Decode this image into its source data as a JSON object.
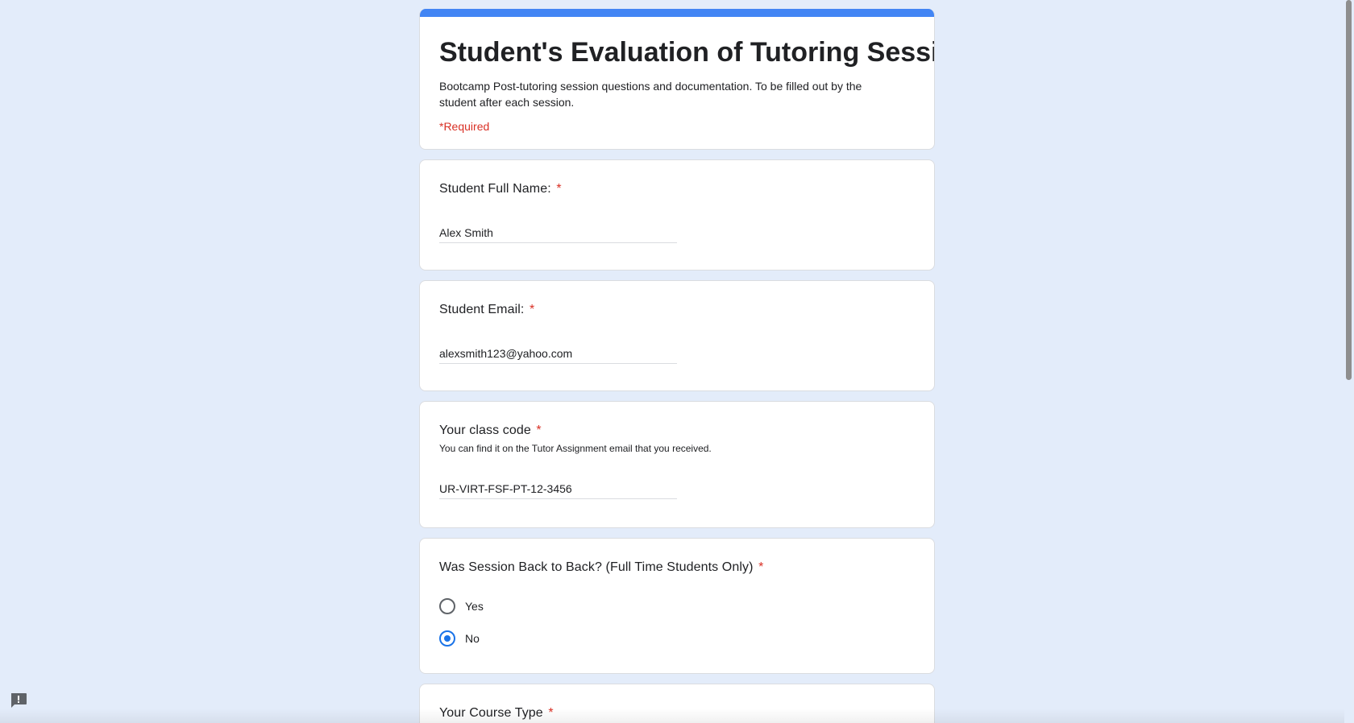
{
  "header": {
    "title": "Student's Evaluation of Tutoring Session.",
    "description": "Bootcamp Post-tutoring session questions and documentation.  To be filled out by the student after each session.",
    "required_note": "*Required",
    "accent_color": "#4285f4"
  },
  "questions": {
    "full_name": {
      "title": "Student Full Name:",
      "required_mark": "*",
      "value": "Alex Smith"
    },
    "email": {
      "title": "Student Email:",
      "required_mark": "*",
      "value": "alexsmith123@yahoo.com"
    },
    "class_code": {
      "title": "Your class code",
      "required_mark": "*",
      "help": "You can find it on the Tutor Assignment email that you received.",
      "value": "UR-VIRT-FSF-PT-12-3456"
    },
    "back_to_back": {
      "title": "Was Session Back to Back? (Full Time Students Only)",
      "required_mark": "*",
      "options": [
        {
          "label": "Yes",
          "selected": false
        },
        {
          "label": "No",
          "selected": true
        }
      ]
    },
    "course_type": {
      "title": "Your Course Type",
      "required_mark": "*"
    }
  },
  "icons": {
    "feedback": "report-issue-icon"
  },
  "colors": {
    "background": "#e3ecfa",
    "required": "#d93025",
    "radio_selected": "#1a73e8"
  }
}
